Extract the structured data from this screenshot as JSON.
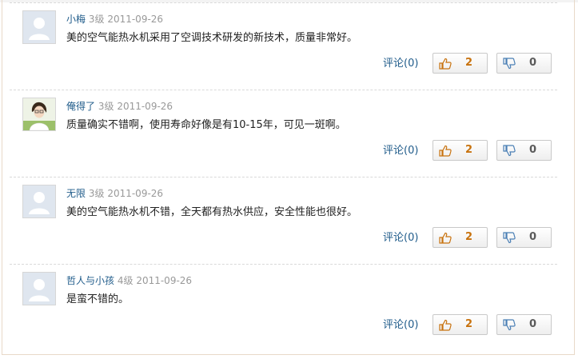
{
  "comments": [
    {
      "username": "小梅",
      "level": "3级",
      "date": "2011-09-26",
      "text": "美的空气能热水机采用了空调技术研发的新技术，质量非常好。",
      "reply_label": "评论(0)",
      "likes": "2",
      "dislikes": "0",
      "avatar": "default-avatar-icon"
    },
    {
      "username": "俺得了",
      "level": "3级",
      "date": "2011-09-26",
      "text": "质量确实不错啊，使用寿命好像是有10-15年，可见一斑啊。",
      "reply_label": "评论(0)",
      "likes": "2",
      "dislikes": "0",
      "avatar": "user-photo-avatar"
    },
    {
      "username": "无限",
      "level": "3级",
      "date": "2011-09-26",
      "text": "美的空气能热水机不错，全天都有热水供应，安全性能也很好。",
      "reply_label": "评论(0)",
      "likes": "2",
      "dislikes": "0",
      "avatar": "default-avatar-icon"
    },
    {
      "username": "哲人与小孩",
      "level": "4级",
      "date": "2011-09-26",
      "text": "是蛮不错的。",
      "reply_label": "评论(0)",
      "likes": "2",
      "dislikes": "0",
      "avatar": "default-avatar-icon"
    }
  ],
  "colors": {
    "username": "#1f5b8a",
    "meta": "#999999",
    "like_count": "#c8720e",
    "dislike_count": "#5a5a5a",
    "separator": "#d9d9d9"
  },
  "icons": {
    "like": "thumbs-up-icon",
    "dislike": "thumbs-down-icon"
  }
}
